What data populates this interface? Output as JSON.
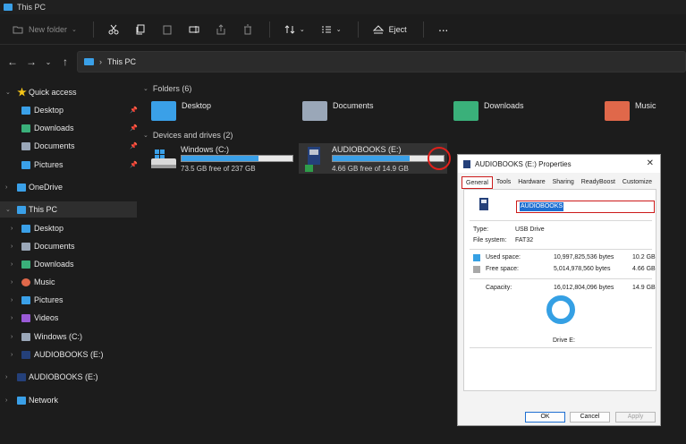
{
  "window": {
    "title": "This PC"
  },
  "toolbar": {
    "new_folder": "New folder",
    "eject": "Eject",
    "more": "···"
  },
  "address": {
    "crumb": "This PC"
  },
  "sidebar": {
    "items": [
      {
        "label": "Quick access",
        "icon": "star-icon",
        "color": "#f5c518"
      },
      {
        "label": "Desktop",
        "icon": "desktop-icon",
        "color": "#3aa0e8",
        "pinned": true
      },
      {
        "label": "Downloads",
        "icon": "download-icon",
        "color": "#3ab07a",
        "pinned": true
      },
      {
        "label": "Documents",
        "icon": "documents-icon",
        "color": "#9aa7b8",
        "pinned": true
      },
      {
        "label": "Pictures",
        "icon": "pictures-icon",
        "color": "#3aa0e8",
        "pinned": true
      },
      {
        "label": "OneDrive",
        "icon": "cloud-icon",
        "color": "#3aa0e8"
      },
      {
        "label": "This PC",
        "icon": "pc-icon",
        "color": "#3aa0e8",
        "selected": true
      },
      {
        "label": "Desktop",
        "icon": "desktop-icon",
        "color": "#3aa0e8"
      },
      {
        "label": "Documents",
        "icon": "documents-icon",
        "color": "#9aa7b8"
      },
      {
        "label": "Downloads",
        "icon": "download-icon",
        "color": "#3ab07a"
      },
      {
        "label": "Music",
        "icon": "music-icon",
        "color": "#e0684a"
      },
      {
        "label": "Pictures",
        "icon": "pictures-icon",
        "color": "#3aa0e8"
      },
      {
        "label": "Videos",
        "icon": "videos-icon",
        "color": "#9a5ad6"
      },
      {
        "label": "Windows (C:)",
        "icon": "drive-icon",
        "color": "#9aa7b8"
      },
      {
        "label": "AUDIOBOOKS (E:)",
        "icon": "usb-drive-icon",
        "color": "#24407a"
      },
      {
        "label": "AUDIOBOOKS (E:)",
        "icon": "usb-drive-icon",
        "color": "#24407a"
      },
      {
        "label": "Network",
        "icon": "network-icon",
        "color": "#3aa0e8"
      }
    ]
  },
  "folders": {
    "header": "Folders (6)",
    "items": [
      {
        "label": "Desktop",
        "color": "#3aa0e8"
      },
      {
        "label": "Documents",
        "color": "#9aa7b8"
      },
      {
        "label": "Downloads",
        "color": "#3ab07a"
      },
      {
        "label": "Music",
        "color": "#e0684a"
      }
    ]
  },
  "drives": {
    "header": "Devices and drives (2)",
    "items": [
      {
        "label": "Windows (C:)",
        "free": "73.5 GB free of 237 GB",
        "used_fraction": 0.69
      },
      {
        "label": "AUDIOBOOKS (E:)",
        "free": "4.66 GB free of 14.9 GB",
        "used_fraction": 0.69
      }
    ]
  },
  "dialog": {
    "title": "AUDIOBOOKS (E:) Properties",
    "tabs": [
      "General",
      "Tools",
      "Hardware",
      "Sharing",
      "ReadyBoost",
      "Customize"
    ],
    "name_value": "AUDIOBOOKS",
    "type_label": "Type:",
    "type_value": "USB Drive",
    "fs_label": "File system:",
    "fs_value": "FAT32",
    "used_label": "Used space:",
    "used_bytes": "10,997,825,536 bytes",
    "used_gb": "10.2 GB",
    "free_label": "Free space:",
    "free_bytes": "5,014,978,560 bytes",
    "free_gb": "4.66 GB",
    "cap_label": "Capacity:",
    "cap_bytes": "16,012,804,096 bytes",
    "cap_gb": "14.9 GB",
    "drive_label": "Drive E:",
    "used_color": "#35a0e4",
    "free_color": "#a8a8a8",
    "ok": "OK",
    "cancel": "Cancel",
    "apply": "Apply"
  }
}
